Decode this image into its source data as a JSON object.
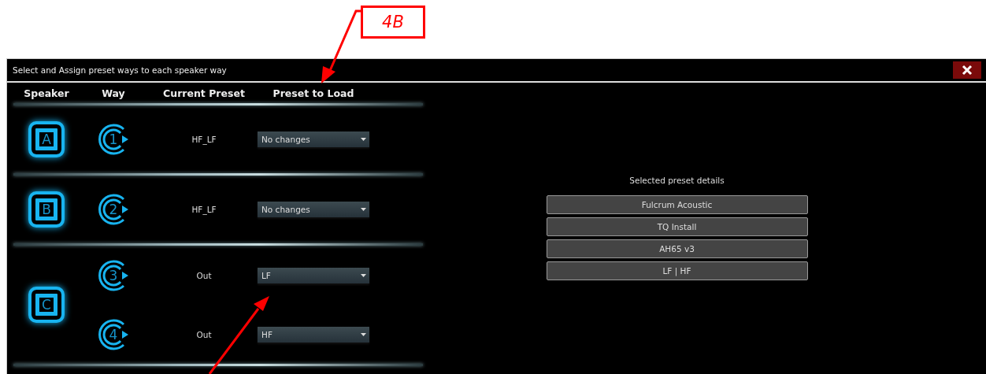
{
  "annotation": {
    "label": "4B"
  },
  "window": {
    "title": "Select and Assign preset ways to each speaker way"
  },
  "headers": [
    "Speaker",
    "Way",
    "Current Preset",
    "Preset to Load"
  ],
  "speakers": [
    {
      "letter": "A",
      "ways": [
        {
          "number": "1",
          "current": "HF_LF",
          "preset": "No changes"
        }
      ]
    },
    {
      "letter": "B",
      "ways": [
        {
          "number": "2",
          "current": "HF_LF",
          "preset": "No changes"
        }
      ]
    },
    {
      "letter": "C",
      "ways": [
        {
          "number": "3",
          "current": "Out",
          "preset": "LF"
        },
        {
          "number": "4",
          "current": "Out",
          "preset": "HF"
        }
      ]
    }
  ],
  "details": {
    "title": "Selected preset details",
    "items": [
      "Fulcrum Acoustic",
      "TQ Install",
      "AH65 v3",
      "LF | HF"
    ]
  }
}
